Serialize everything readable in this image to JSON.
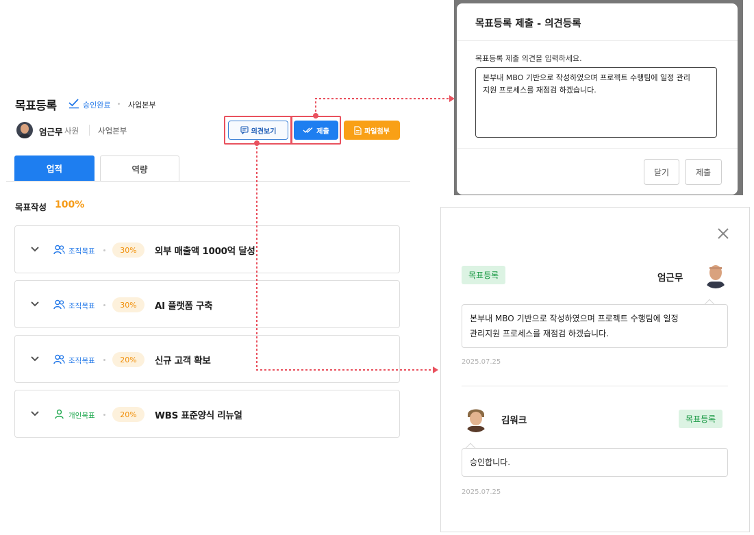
{
  "header": {
    "title": "목표등록",
    "status": "승인완료",
    "department": "사업본부"
  },
  "user": {
    "name": "엄근무",
    "rank": "사원",
    "department": "사업본부"
  },
  "actions": {
    "opinion_label": "의견보기",
    "submit_label": "제출",
    "attach_label": "파일첨부"
  },
  "tabs": [
    {
      "label": "업적",
      "active": true
    },
    {
      "label": "역량",
      "active": false
    }
  ],
  "progress": {
    "label": "목표작성",
    "value": "100%"
  },
  "goals": [
    {
      "type": "조직목표",
      "weight": "30%",
      "title": "외부 매출액 1000억 달성",
      "type_color": "#2177e8"
    },
    {
      "type": "조직목표",
      "weight": "30%",
      "title": "AI 플랫폼 구축",
      "type_color": "#2177e8"
    },
    {
      "type": "조직목표",
      "weight": "20%",
      "title": "신규 고객 확보",
      "type_color": "#2177e8"
    },
    {
      "type": "개인목표",
      "weight": "20%",
      "title": "WBS 표준양식 리뉴얼",
      "type_color": "#1ea84e"
    }
  ],
  "modal": {
    "title": "목표등록 제출 - 의견등록",
    "label": "목표등록 제출 의견을 입력하세요.",
    "text_line1": "본부내 MBO 기반으로 작성하였으며 프로젝트 수행팀에 일정 관리",
    "text_line2": "지원 프로세스를 재점검 하겠습니다.",
    "close_label": "닫기",
    "submit_label": "제출"
  },
  "comments": [
    {
      "tag": "목표등록",
      "author": "엄근무",
      "text_line1": "본부내 MBO 기반으로 작성하였으며 프로젝트 수행팀에 일정",
      "text_line2": "관리지원 프로세스를 재점검 하겠습니다.",
      "date": "2025.07.25"
    },
    {
      "tag": "목표등록",
      "author": "김워크",
      "text_line1": "승인합니다.",
      "date": "2025.07.25"
    }
  ],
  "colors": {
    "primary": "#1e7ef0",
    "accent_orange": "#f9a016",
    "highlight_red": "#e9515e",
    "tag_green": "#1b9a45"
  }
}
